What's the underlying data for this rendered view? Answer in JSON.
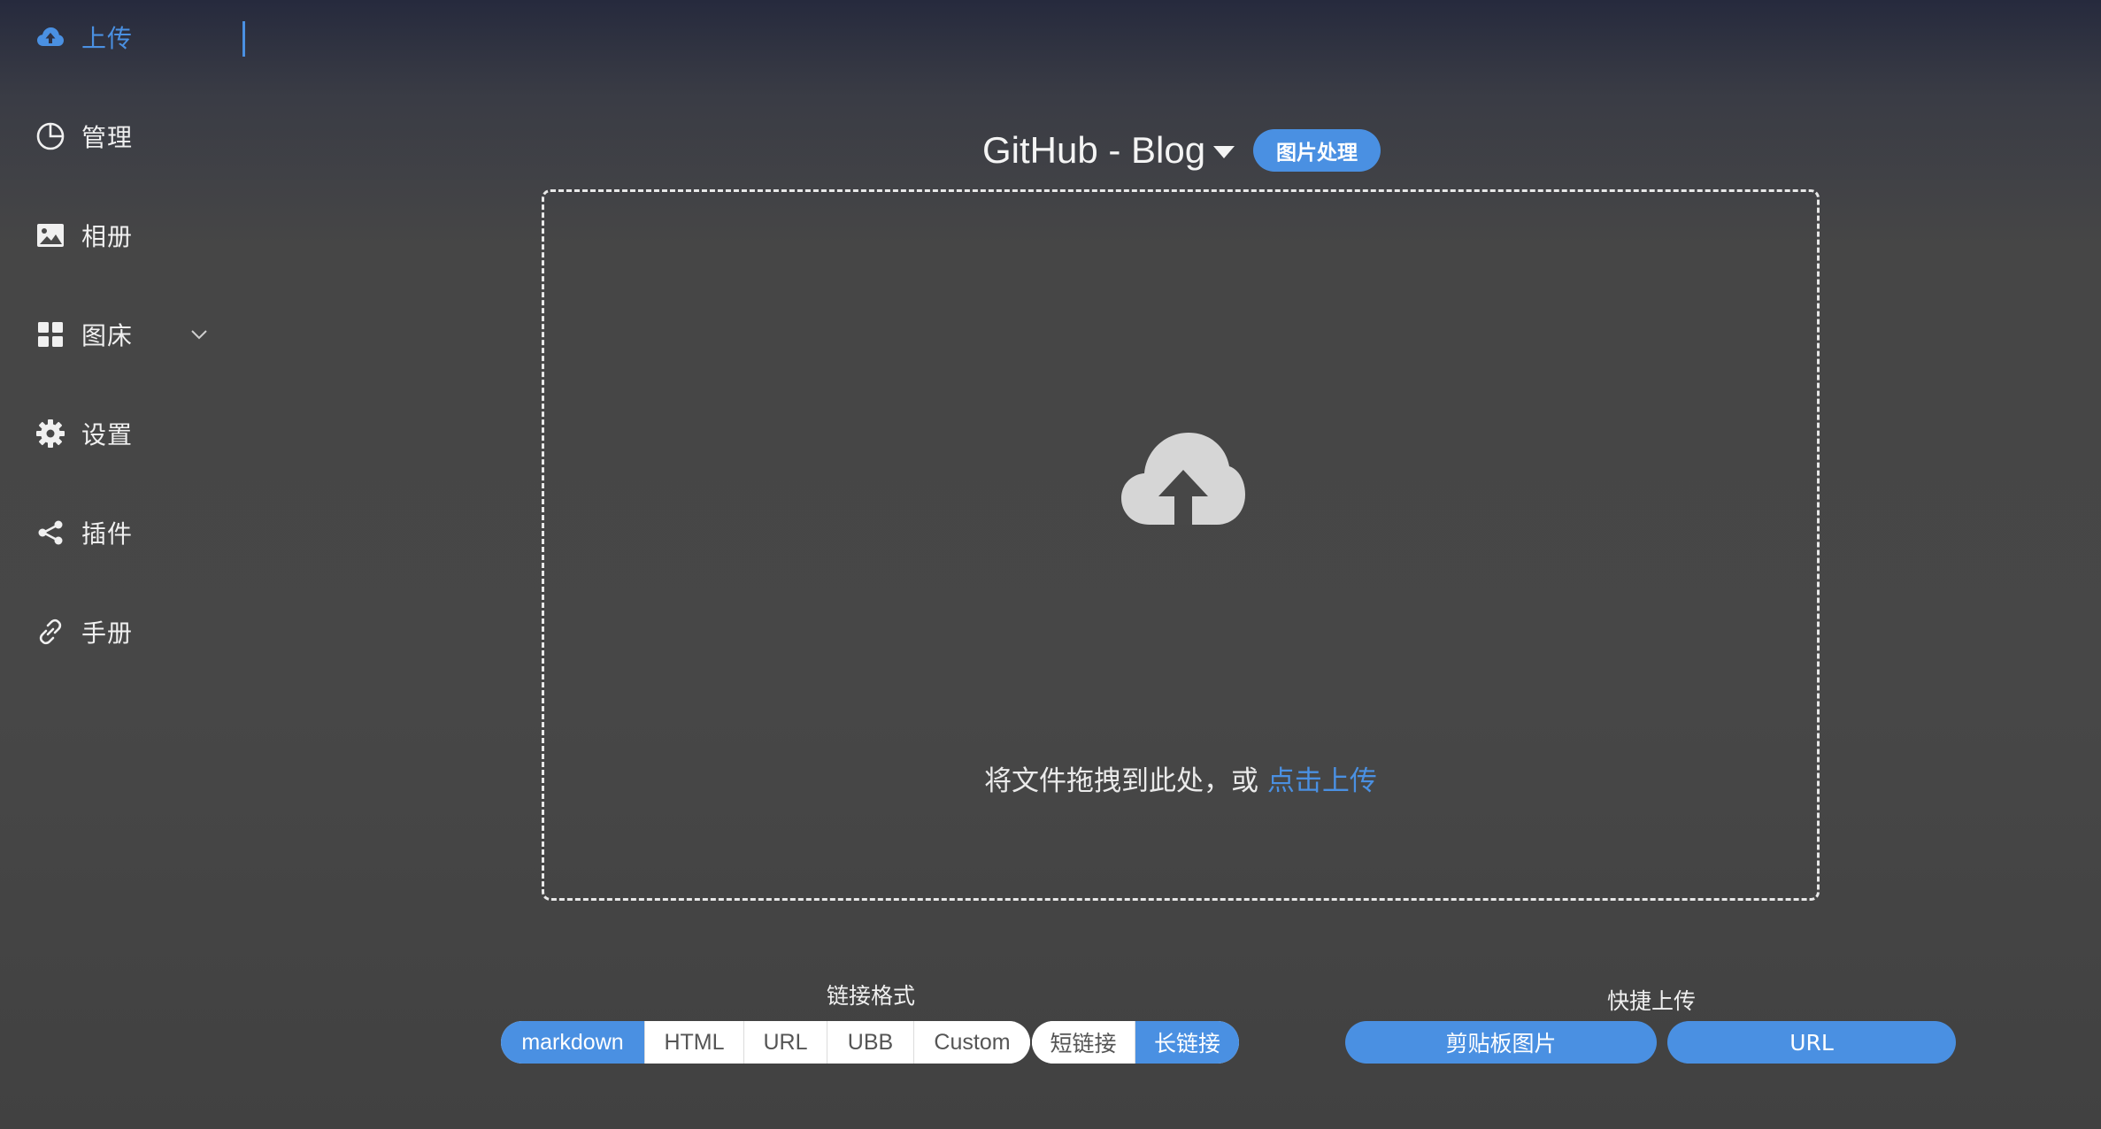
{
  "sidebar": {
    "items": [
      {
        "label": "上传",
        "icon": "cloud-upload-icon",
        "active": true
      },
      {
        "label": "管理",
        "icon": "pie-chart-icon"
      },
      {
        "label": "相册",
        "icon": "picture-icon"
      },
      {
        "label": "图床",
        "icon": "grid-icon",
        "expandable": true
      },
      {
        "label": "设置",
        "icon": "gear-icon"
      },
      {
        "label": "插件",
        "icon": "share-icon"
      },
      {
        "label": "手册",
        "icon": "link-icon"
      }
    ]
  },
  "header": {
    "picbed": "GitHub - Blog",
    "process_button": "图片处理"
  },
  "dropzone": {
    "text": "将文件拖拽到此处，或 ",
    "link": "点击上传"
  },
  "link_format": {
    "label": "链接格式",
    "options": [
      "markdown",
      "HTML",
      "URL",
      "UBB",
      "Custom"
    ],
    "selected": "markdown"
  },
  "link_length": {
    "options": [
      "短链接",
      "长链接"
    ],
    "selected": "长链接"
  },
  "quick_upload": {
    "label": "快捷上传",
    "clipboard_button": "剪贴板图片",
    "url_button": "URL"
  },
  "colors": {
    "accent": "#4a90e2",
    "background": "#474747",
    "text": "#f0f0f0"
  }
}
